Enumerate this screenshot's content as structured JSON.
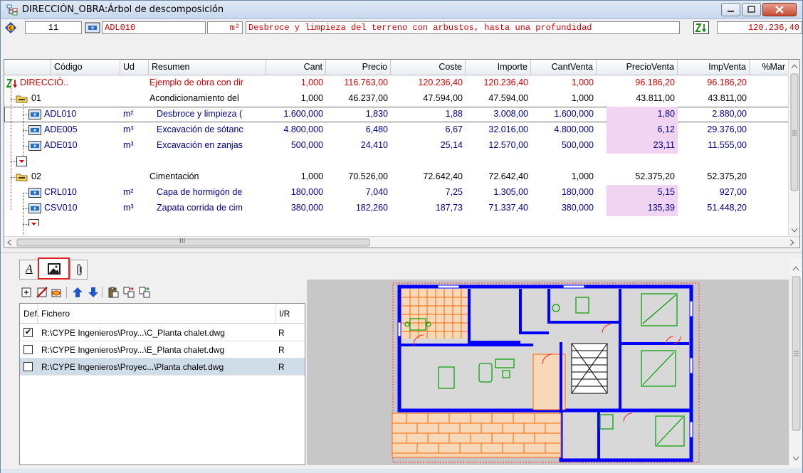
{
  "window": {
    "title": "DIRECCIÓN_OBRA:Árbol de descomposición"
  },
  "toolbar": {
    "level_value": "11",
    "code_value": "ADL010",
    "unit_value": "m²",
    "summary_value": "Desbroce y limpieza del terreno con arbustos, hasta una profundidad",
    "total_value": "120.236,40"
  },
  "grid": {
    "columns": [
      "Código",
      "Ud",
      "Resumen",
      "Cant",
      "Precio",
      "Coste",
      "Importe",
      "CantVenta",
      "PrecioVenta",
      "ImpVenta",
      "%Mar"
    ],
    "rows": [
      {
        "code": "DIRECCIÓ..",
        "ud": "",
        "resumen": "Ejemplo de obra con dir",
        "cant": "1,000",
        "precio": "116.763,00",
        "coste": "120.236,40",
        "importe": "120.236,40",
        "cantventa": "1,000",
        "precioventa": "96.186,20",
        "impventa": "96.186,20",
        "style": "root"
      },
      {
        "code": "01",
        "ud": "",
        "resumen": "Acondicionamiento del",
        "cant": "1,000",
        "precio": "46.237,00",
        "coste": "47.594,00",
        "importe": "47.594,00",
        "cantventa": "1,000",
        "precioventa": "43.811,00",
        "impventa": "43.811,00",
        "style": "chapter"
      },
      {
        "code": "ADL010",
        "ud": "m²",
        "resumen": "Desbroce y limpieza (",
        "cant": "1.600,000",
        "precio": "1,830",
        "coste": "1,88",
        "importe": "3.008,00",
        "cantventa": "1.600,000",
        "precioventa": "1,80",
        "impventa": "2.880,00",
        "style": "item"
      },
      {
        "code": "ADE005",
        "ud": "m³",
        "resumen": "Excavación de sótanc",
        "cant": "4.800,000",
        "precio": "6,480",
        "coste": "6,67",
        "importe": "32.016,00",
        "cantventa": "4.800,000",
        "precioventa": "6,12",
        "impventa": "29.376,00",
        "style": "item"
      },
      {
        "code": "ADE010",
        "ud": "m³",
        "resumen": "Excavación en zanjas",
        "cant": "500,000",
        "precio": "24,410",
        "coste": "25,14",
        "importe": "12.570,00",
        "cantventa": "500,000",
        "precioventa": "23,11",
        "impventa": "11.555,00",
        "style": "item"
      },
      {
        "code": "",
        "ud": "",
        "resumen": "",
        "cant": "",
        "precio": "",
        "coste": "",
        "importe": "",
        "cantventa": "",
        "precioventa": "",
        "impventa": "",
        "style": "empty"
      },
      {
        "code": "02",
        "ud": "",
        "resumen": "Cimentación",
        "cant": "1,000",
        "precio": "70.526,00",
        "coste": "72.642,40",
        "importe": "72.642,40",
        "cantventa": "1,000",
        "precioventa": "52.375,20",
        "impventa": "52.375,20",
        "style": "chapter"
      },
      {
        "code": "CRL010",
        "ud": "m²",
        "resumen": "Capa de hormigón de",
        "cant": "180,000",
        "precio": "7,040",
        "coste": "7,25",
        "importe": "1.305,00",
        "cantventa": "180,000",
        "precioventa": "5,15",
        "impventa": "927,00",
        "style": "item"
      },
      {
        "code": "CSV010",
        "ud": "m³",
        "resumen": "Zapata corrida de cim",
        "cant": "380,000",
        "precio": "182,260",
        "coste": "187,73",
        "importe": "71.337,40",
        "cantventa": "380,000",
        "precioventa": "135,39",
        "impventa": "51.448,20",
        "style": "item"
      }
    ],
    "hscroll_marker": "III"
  },
  "lower_panel": {
    "tab_text_label": "A",
    "files": {
      "columns": [
        "Def.",
        "Fichero",
        "I/R"
      ],
      "rows": [
        {
          "checked": true,
          "file": "R:\\CYPE Ingenieros\\Proy...\\C_Planta chalet.dwg",
          "ir": "R"
        },
        {
          "checked": false,
          "file": "R:\\CYPE Ingenieros\\Proy...\\E_Planta chalet.dwg",
          "ir": "R"
        },
        {
          "checked": false,
          "file": "R:\\CYPE Ingenieros\\Proyec...\\Planta chalet.dwg",
          "ir": "R"
        }
      ]
    }
  },
  "colors": {
    "red_text": "#d40000",
    "blue_text": "#00008b",
    "highlight_pink": "#f0d4f2",
    "selected_tab_outline": "#e02020",
    "plan_walls": "#0000ff",
    "plan_lines": "#ff6600"
  }
}
